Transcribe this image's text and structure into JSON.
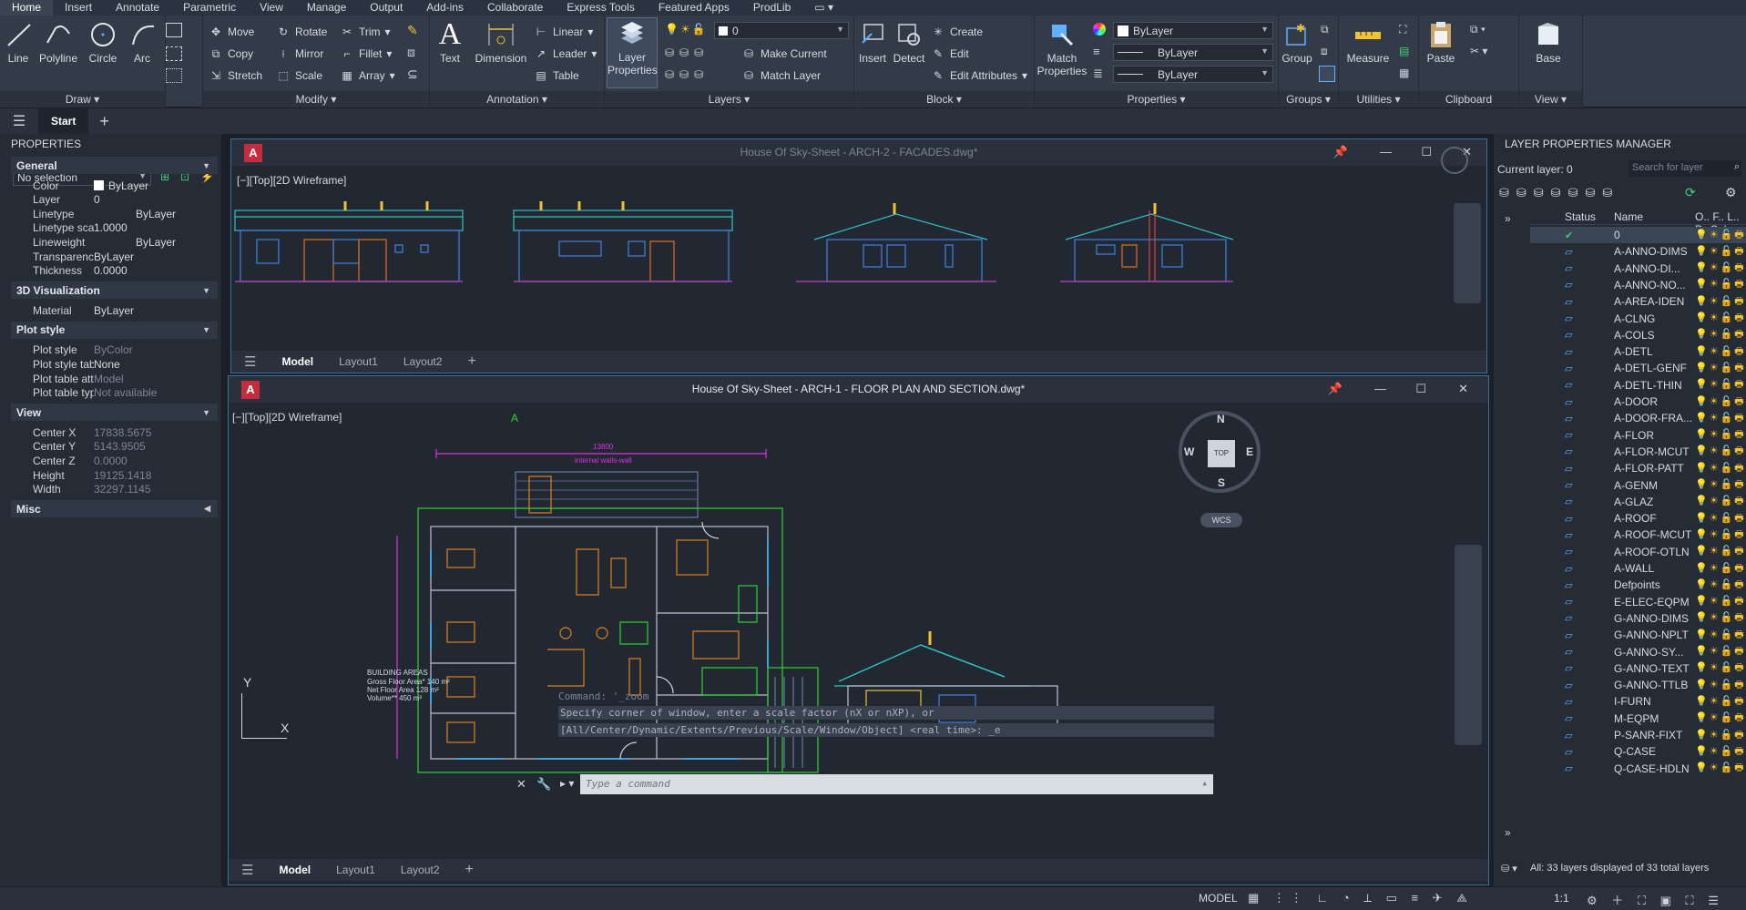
{
  "menu": [
    "Home",
    "Insert",
    "Annotate",
    "Parametric",
    "View",
    "Manage",
    "Output",
    "Add-ins",
    "Collaborate",
    "Express Tools",
    "Featured Apps",
    "ProdLib"
  ],
  "ribbon": {
    "draw": {
      "title": "Draw",
      "line": "Line",
      "polyline": "Polyline",
      "circle": "Circle",
      "arc": "Arc"
    },
    "modify": {
      "title": "Modify",
      "move": "Move",
      "rotate": "Rotate",
      "trim": "Trim",
      "copy": "Copy",
      "mirror": "Mirror",
      "fillet": "Fillet",
      "stretch": "Stretch",
      "scale": "Scale",
      "array": "Array"
    },
    "annotation": {
      "title": "Annotation",
      "text": "Text",
      "dimension": "Dimension",
      "linear": "Linear",
      "leader": "Leader",
      "table": "Table"
    },
    "layers": {
      "title": "Layers",
      "layer_properties_1": "Layer",
      "layer_properties_2": "Properties",
      "layer_value": "0",
      "make_current": "Make Current",
      "match_layer": "Match Layer"
    },
    "block": {
      "title": "Block",
      "insert": "Insert",
      "detect": "Detect",
      "create": "Create",
      "edit": "Edit",
      "edit_attributes": "Edit Attributes"
    },
    "properties": {
      "title": "Properties",
      "match_1": "Match",
      "match_2": "Properties",
      "color": "ByLayer",
      "linetype": "ByLayer",
      "lineweight": "ByLayer"
    },
    "groups": {
      "title": "Groups",
      "group": "Group"
    },
    "utilities": {
      "title": "Utilities",
      "measure": "Measure"
    },
    "clipboard": {
      "title": "Clipboard",
      "paste": "Paste"
    },
    "view": {
      "title": "View",
      "base": "Base"
    }
  },
  "tabs": {
    "start": "Start"
  },
  "properties_panel": {
    "title": "PROPERTIES",
    "selection": "No selection",
    "general": {
      "title": "General",
      "rows": [
        [
          "Color",
          "ByLayer"
        ],
        [
          "Layer",
          "0"
        ],
        [
          "Linetype",
          "ByLayer"
        ],
        [
          "Linetype scale",
          "1.0000"
        ],
        [
          "Lineweight",
          "ByLayer"
        ],
        [
          "Transparency",
          "ByLayer"
        ],
        [
          "Thickness",
          "0.0000"
        ]
      ]
    },
    "viz": {
      "title": "3D Visualization",
      "rows": [
        [
          "Material",
          "ByLayer"
        ]
      ]
    },
    "plot": {
      "title": "Plot style",
      "rows": [
        [
          "Plot style",
          "ByColor"
        ],
        [
          "Plot style table",
          "None"
        ],
        [
          "Plot table att...",
          "Model"
        ],
        [
          "Plot table type",
          "Not available"
        ]
      ]
    },
    "view": {
      "title": "View",
      "rows": [
        [
          "Center X",
          "17838.5675"
        ],
        [
          "Center Y",
          "5143.9505"
        ],
        [
          "Center Z",
          "0.0000"
        ],
        [
          "Height",
          "19125.1418"
        ],
        [
          "Width",
          "32297.1145"
        ]
      ]
    },
    "misc": {
      "title": "Misc"
    }
  },
  "window1": {
    "title": "House Of Sky-Sheet - ARCH-2 - FACADES.dwg*",
    "viewport": "[−][Top][2D Wireframe]",
    "tabs": [
      "Model",
      "Layout1",
      "Layout2"
    ]
  },
  "window2": {
    "title": "House Of Sky-Sheet - ARCH-1 - FLOOR PLAN AND SECTION.dwg*",
    "viewport": "[−][Top][2D Wireframe]",
    "tabs": [
      "Model",
      "Layout1",
      "Layout2"
    ],
    "compass": {
      "n": "N",
      "s": "S",
      "e": "E",
      "w": "W",
      "top": "TOP",
      "wcs": "WCS"
    },
    "plan_labels": {
      "dim_top": "13800",
      "dim_top_sub": "internal walls-wall",
      "areas_title": "BUILDING AREAS",
      "area1": "Gross Floor Area* 140 m²",
      "area2": "Net Floor Area 128 m²",
      "area3": "Volume** 450 m³",
      "section_mark": "A",
      "axis_y": "Y",
      "axis_x": "X"
    }
  },
  "command": {
    "history1": "Command: '_zoom",
    "history2": "Specify corner of window, enter a scale factor (nX or nXP), or",
    "history3": "[All/Center/Dynamic/Extents/Previous/Scale/Window/Object] <real time>: _e",
    "placeholder": "Type a command"
  },
  "layer_panel": {
    "title": "LAYER PROPERTIES MANAGER",
    "current": "Current layer: 0",
    "search": "Search for layer",
    "col_status": "Status",
    "col_name": "Name",
    "footer": "All: 33 layers displayed of 33 total layers",
    "layers": [
      {
        "name": "0",
        "color": "#ffffff",
        "code": "w"
      },
      {
        "name": "A-ANNO-DIMS",
        "color": "#c040c0",
        "code": "2"
      },
      {
        "name": "A-ANNO-DI...",
        "color": "#ff66cc",
        "code": "2"
      },
      {
        "name": "A-ANNO-NO...",
        "color": "#40c0c0",
        "code": "1"
      },
      {
        "name": "A-AREA-IDEN",
        "color": "#e8e800",
        "code": "ye"
      },
      {
        "name": "A-CLNG",
        "color": "#d06060",
        "code": "1"
      },
      {
        "name": "A-COLS",
        "color": "#b0a040",
        "code": "5"
      },
      {
        "name": "A-DETL",
        "color": "#30d030",
        "code": "9"
      },
      {
        "name": "A-DETL-GENF",
        "color": "#30b030",
        "code": "9"
      },
      {
        "name": "A-DETL-THIN",
        "color": "#5080d0",
        "code": "1"
      },
      {
        "name": "A-DOOR",
        "color": "#e07020",
        "code": "3"
      },
      {
        "name": "A-DOOR-FRA...",
        "color": "#e08040",
        "code": "3"
      },
      {
        "name": "A-FLOR",
        "color": "#4040d0",
        "code": "1"
      },
      {
        "name": "A-FLOR-MCUT",
        "color": "#e8c000",
        "code": "5"
      },
      {
        "name": "A-FLOR-PATT",
        "color": "#909090",
        "code": "8"
      },
      {
        "name": "A-GENM",
        "color": "#e07020",
        "code": "3"
      },
      {
        "name": "A-GLAZ",
        "color": "#40a0e0",
        "code": "1"
      },
      {
        "name": "A-ROOF",
        "color": "#20c0a0",
        "code": "1"
      },
      {
        "name": "A-ROOF-MCUT",
        "color": "#30c0c0",
        "code": "1"
      },
      {
        "name": "A-ROOF-OTLN",
        "color": "#30a0a0",
        "code": "1"
      },
      {
        "name": "A-WALL",
        "color": "#40b040",
        "code": "1"
      },
      {
        "name": "Defpoints",
        "color": "#ffffff",
        "code": "w"
      },
      {
        "name": "E-ELEC-EQPM",
        "color": "#30c060",
        "code": "7"
      },
      {
        "name": "G-ANNO-DIMS",
        "color": "#30c0a0",
        "code": "1"
      },
      {
        "name": "G-ANNO-NPLT",
        "color": "#e03070",
        "code": "1"
      },
      {
        "name": "G-ANNO-SY...",
        "color": "#30c060",
        "code": "1"
      },
      {
        "name": "G-ANNO-TEXT",
        "color": "#e06020",
        "code": "2"
      },
      {
        "name": "G-ANNO-TTLB",
        "color": "#e030e0",
        "code": "m"
      },
      {
        "name": "I-FURN",
        "color": "#e08020",
        "code": "3"
      },
      {
        "name": "M-EQPM",
        "color": "#e8c000",
        "code": "5"
      },
      {
        "name": "P-SANR-FIXT",
        "color": "#e030e0",
        "code": "m"
      },
      {
        "name": "Q-CASE",
        "color": "#e07020",
        "code": "3"
      },
      {
        "name": "Q-CASE-HDLN",
        "color": "#e07020",
        "code": "3"
      }
    ]
  },
  "status": {
    "model": "MODEL",
    "scale": "1:1"
  }
}
